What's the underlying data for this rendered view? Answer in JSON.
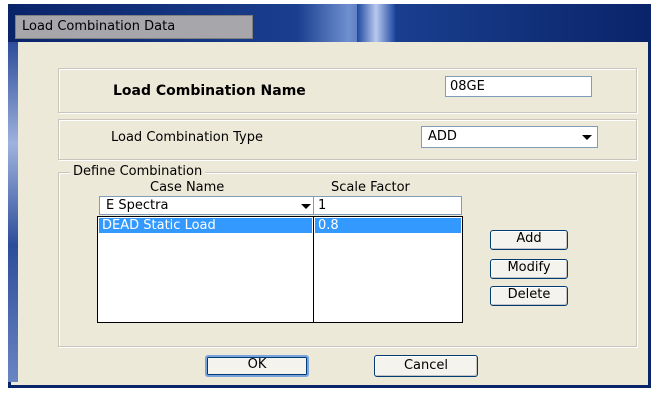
{
  "window": {
    "title": "Load Combination Data"
  },
  "name_section": {
    "label": "Load Combination Name",
    "value": "08GE"
  },
  "type_section": {
    "label": "Load Combination Type",
    "selected": "ADD"
  },
  "define": {
    "legend": "Define Combination",
    "case_header": "Case Name",
    "scale_header": "Scale Factor",
    "case_selected": "E Spectra",
    "scale_value": "1",
    "case_items": [
      "DEAD Static Load"
    ],
    "scale_items": [
      "0.8"
    ]
  },
  "buttons": {
    "add": "Add",
    "modify": "Modify",
    "delete": "Delete",
    "ok": "OK",
    "cancel": "Cancel"
  }
}
